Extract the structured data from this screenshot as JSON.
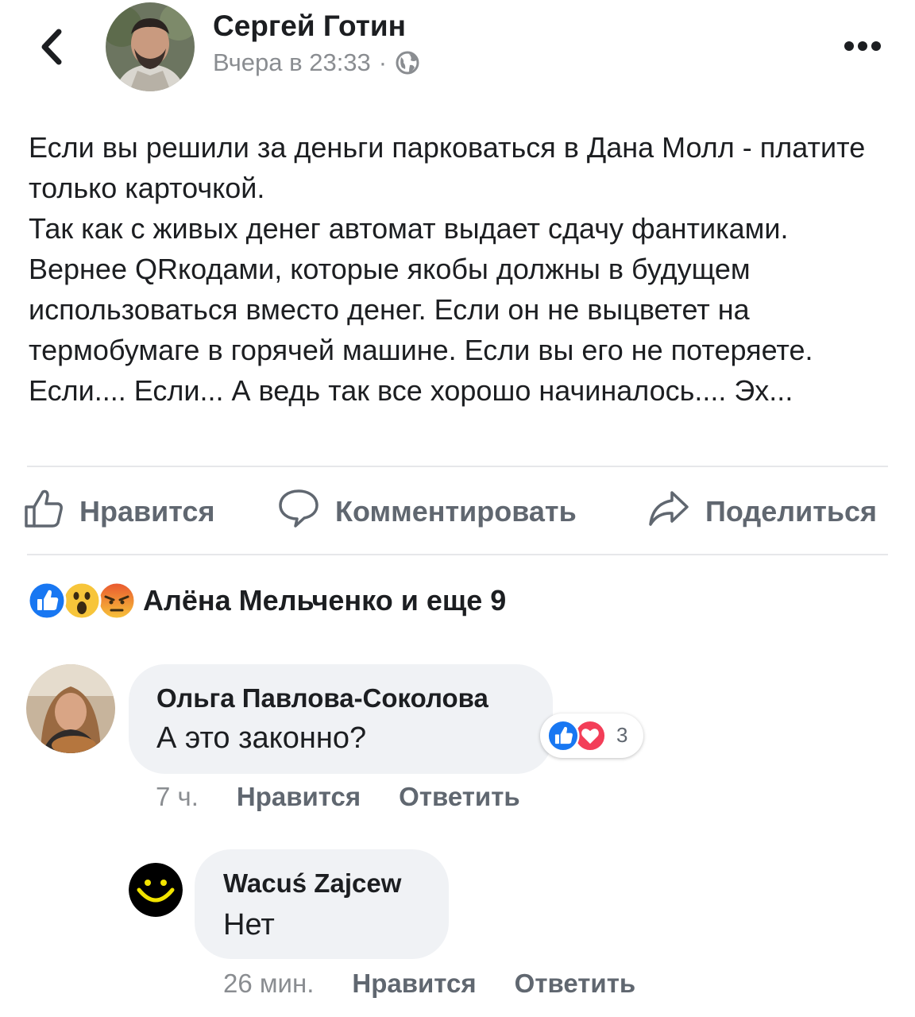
{
  "header": {
    "author_name": "Сергей Готин",
    "time": "Вчера в 23:33",
    "separator": "·",
    "privacy_icon": "globe-icon",
    "back_icon": "chevron-left-icon",
    "more_icon": "more-dots-icon"
  },
  "post": {
    "text": "Если вы решили за деньги парковаться в Дана Молл - платите только карточкой.\nТак как с живых денег автомат выдает сдачу фантиками. Вернее QRкодами, которые якобы должны в будущем использоваться вместо денег. Если он не выцветет на термобумаге в горячей машине. Если вы его не потеряете. Если.... Если... А ведь так все хорошо начиналось.... Эх..."
  },
  "actions": {
    "like": "Нравится",
    "comment": "Комментировать",
    "share": "Поделиться"
  },
  "reactions": {
    "summary": "Алёна Мельченко и еще 9",
    "icons": [
      "like-reaction-icon",
      "wow-reaction-icon",
      "angry-reaction-icon"
    ]
  },
  "comments": [
    {
      "author": "Ольга Павлова-Соколова",
      "text": "А это законно?",
      "time": "7 ч.",
      "like": "Нравится",
      "reply": "Ответить",
      "reaction_count": "3",
      "reaction_icons": [
        "like-reaction-icon",
        "love-reaction-icon"
      ]
    },
    {
      "author": "Wacuś Zajcew",
      "text": "Нет",
      "time": "26 мин.",
      "like": "Нравится",
      "reply": "Ответить"
    }
  ],
  "colors": {
    "text": "#1c1e21",
    "secondary": "#606770",
    "meta": "#8a8d91",
    "bubble": "#f0f2f5",
    "like_blue": "#1877f2",
    "love_red": "#f33e58"
  }
}
